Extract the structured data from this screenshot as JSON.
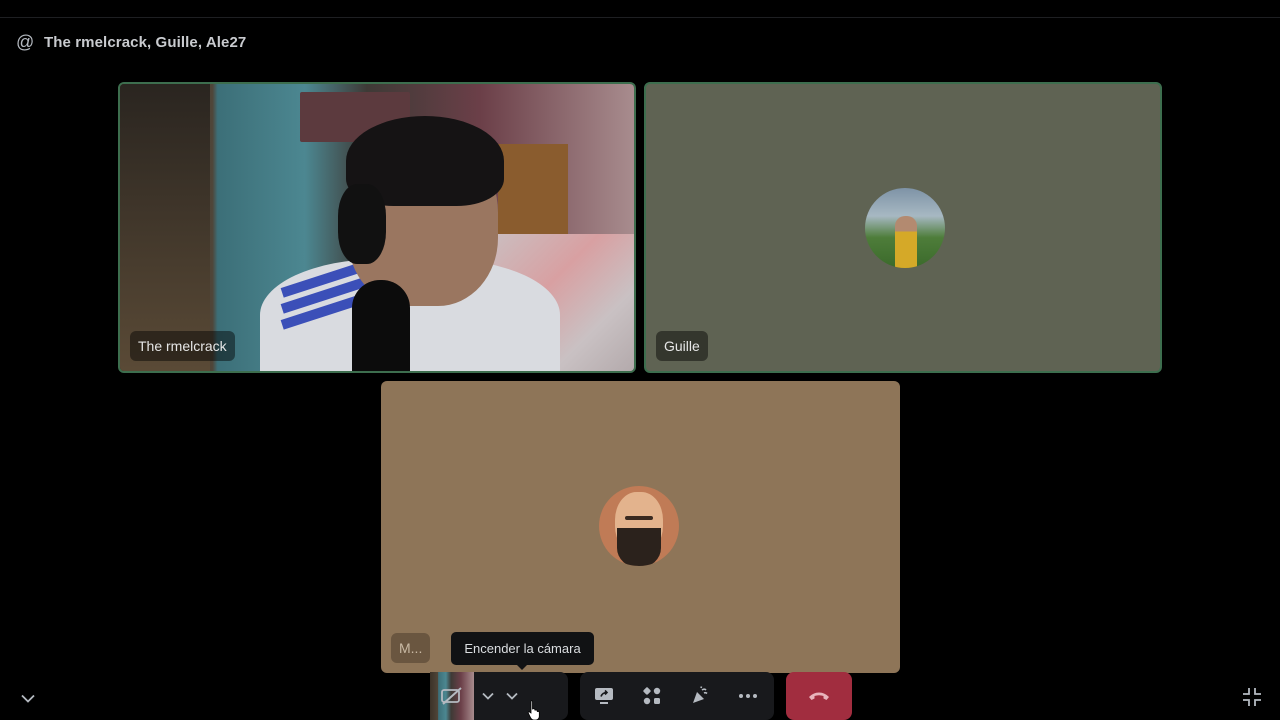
{
  "header": {
    "icon": "at-icon",
    "title": "The rmelcrack, Guille, Ale27"
  },
  "participants": [
    {
      "name": "The rmelcrack",
      "video": "camera-feed",
      "speaking": true
    },
    {
      "name": "Guille",
      "video": "avatar",
      "speaking": true
    },
    {
      "name": "M...",
      "video": "avatar",
      "speaking": false
    }
  ],
  "tooltip": {
    "text": "Encender la cámara"
  },
  "controls": {
    "microphone": "microphone-icon",
    "camera": "camera-off-icon",
    "screen_share": "screen-share-icon",
    "activities": "activities-icon",
    "soundboard": "soundboard-icon",
    "more": "more-icon",
    "leave": "hang-up-icon"
  },
  "colors": {
    "background": "#000000",
    "speaking_border": "#3d6e4e",
    "tile_guille": "#5f6353",
    "tile_third": "#8e7558",
    "leave_button": "#a12d3f",
    "control_group": "#18191c"
  }
}
